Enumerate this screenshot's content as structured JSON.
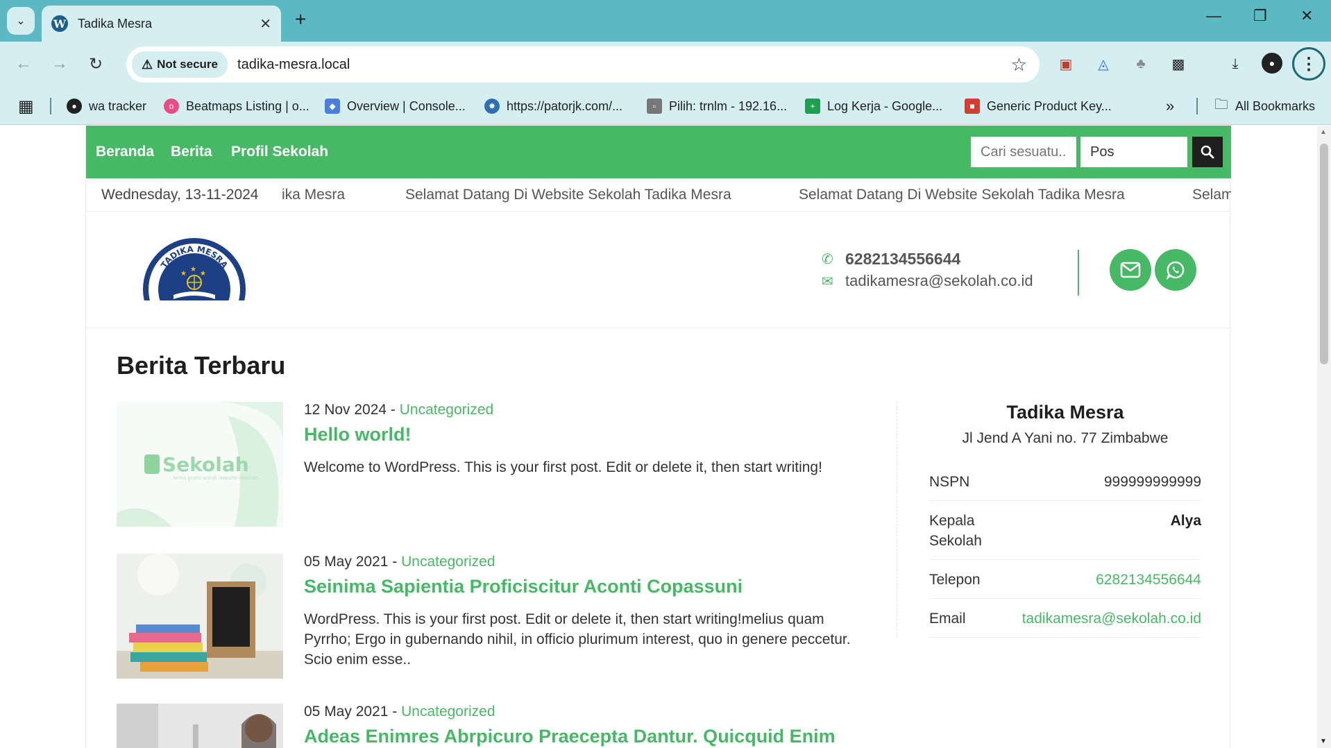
{
  "browser": {
    "tab_title": "Tadika Mesra",
    "security_label": "Not secure",
    "url": "tadika-mesra.local",
    "bookmarks": [
      {
        "label": "wa tracker",
        "color": "#222222"
      },
      {
        "label": "Beatmaps Listing | o...",
        "color": "#e84d8a"
      },
      {
        "label": "Overview | Console...",
        "color": "#4a7fe0"
      },
      {
        "label": "https://patorjk.com/...",
        "color": "#2f6fb0"
      },
      {
        "label": "Pilih: trnlm - 192.16...",
        "color": "#777777"
      },
      {
        "label": "Log Kerja - Google...",
        "color": "#1e9e50"
      },
      {
        "label": "Generic Product Key...",
        "color": "#d04030"
      }
    ],
    "all_bookmarks_label": "All Bookmarks"
  },
  "site": {
    "accent_color": "#47b865",
    "nav": {
      "items": [
        "Beranda",
        "Berita",
        "Profil Sekolah"
      ],
      "search_placeholder": "Cari sesuatu...",
      "search_value": "Pos"
    },
    "ticker": {
      "date": "Wednesday, 13-11-2024",
      "partial_start": "ika Mesra",
      "message": "Selamat Datang Di Website Sekolah Tadika Mesra",
      "partial_end": "Selam"
    },
    "header": {
      "logo_text": "TADIKA MESRA",
      "phone": "6282134556644",
      "email": "tadikamesra@sekolah.co.id"
    },
    "section_title": "Berita Terbaru",
    "posts": [
      {
        "date": "12 Nov 2024",
        "category": "Uncategorized",
        "title": "Hello world!",
        "excerpt": "Welcome to WordPress. This is your first post. Edit or delete it, then start writing!",
        "thumb_text": "Sekolah",
        "thumb_sub": "tema gratis untuk website sekolah"
      },
      {
        "date": "05 May 2021",
        "category": "Uncategorized",
        "title": "Seinima Sapientia Proficiscitur Aconti Copassuni",
        "excerpt": "WordPress. This is your first post. Edit or delete it, then start writing!melius quam Pyrrho; Ergo in gubernando nihil, in officio plurimum interest, quo in genere peccetur. Scio enim esse.."
      },
      {
        "date": "05 May 2021",
        "category": "Uncategorized",
        "title": "Adeas Enimres Abrpicuro Praecepta Dantur. Quicquid Enim",
        "excerpt": ""
      }
    ],
    "sidebar": {
      "school_name": "Tadika Mesra",
      "address": "Jl Jend A Yani no. 77 Zimbabwe",
      "rows": [
        {
          "label": "NSPN",
          "value": "999999999999"
        },
        {
          "label": "Kepala Sekolah",
          "value": "Alya"
        },
        {
          "label": "Telepon",
          "value": "6282134556644"
        },
        {
          "label": "Email",
          "value": "tadikamesra@sekolah.co.id"
        }
      ]
    }
  }
}
